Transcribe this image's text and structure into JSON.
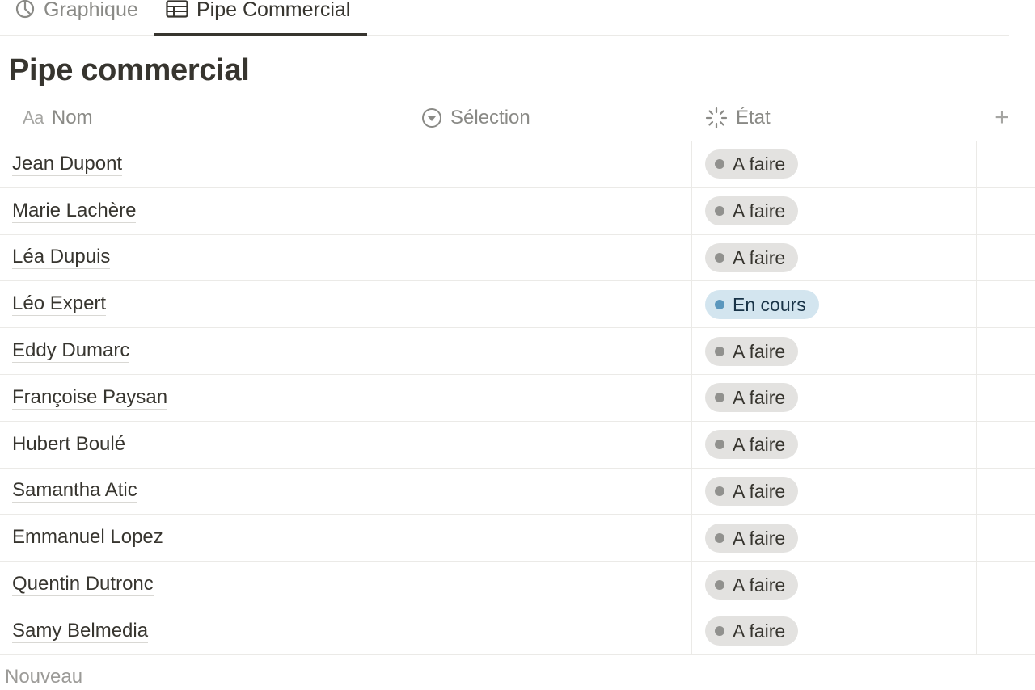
{
  "tabs": [
    {
      "label": "Graphique",
      "icon": "pie-chart-icon",
      "active": false
    },
    {
      "label": "Pipe Commercial",
      "icon": "table-icon",
      "active": true
    }
  ],
  "page": {
    "title": "Pipe commercial"
  },
  "columns": {
    "nom": {
      "label": "Nom",
      "icon_text": "Aa"
    },
    "selection": {
      "label": "Sélection",
      "icon": "select-icon"
    },
    "etat": {
      "label": "État",
      "icon": "status-icon"
    },
    "add": "+"
  },
  "rows": [
    {
      "nom": "Jean Dupont",
      "etat": "A faire",
      "tone": "gray"
    },
    {
      "nom": "Marie Lachère",
      "etat": "A faire",
      "tone": "gray"
    },
    {
      "nom": "Léa Dupuis",
      "etat": "A faire",
      "tone": "gray"
    },
    {
      "nom": "Léo Expert",
      "etat": "En cours",
      "tone": "blue"
    },
    {
      "nom": "Eddy Dumarc",
      "etat": "A faire",
      "tone": "gray"
    },
    {
      "nom": "Françoise Paysan",
      "etat": "A faire",
      "tone": "gray"
    },
    {
      "nom": "Hubert Boulé",
      "etat": "A faire",
      "tone": "gray"
    },
    {
      "nom": "Samantha Atic",
      "etat": "A faire",
      "tone": "gray"
    },
    {
      "nom": "Emmanuel Lopez",
      "etat": "A faire",
      "tone": "gray"
    },
    {
      "nom": "Quentin Dutronc",
      "etat": "A faire",
      "tone": "gray"
    },
    {
      "nom": "Samy Belmedia",
      "etat": "A faire",
      "tone": "gray"
    }
  ],
  "new_row_label": "Nouveau",
  "colors": {
    "gray_pill": "#e3e2e0",
    "blue_pill": "#d3e5ef",
    "blue_dot": "#5b97bd",
    "gray_dot": "#91918e"
  }
}
